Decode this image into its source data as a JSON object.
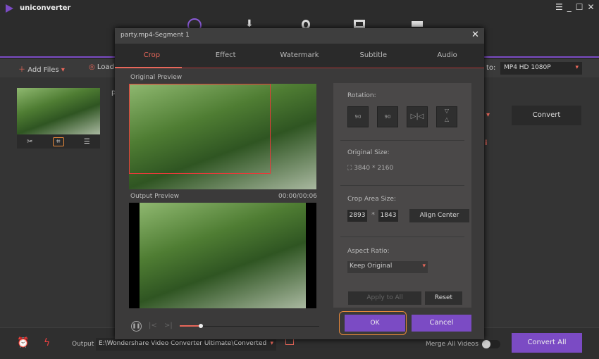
{
  "app": {
    "title": "uniconverter",
    "window_controls": [
      "menu-icon",
      "minimize-icon",
      "maximize-icon",
      "close-icon"
    ]
  },
  "nav_icons": [
    "convert-icon",
    "download-icon",
    "record-icon",
    "transfer-icon",
    "toolbox-icon"
  ],
  "toolbar": {
    "add_files": "Add Files",
    "load": "Load",
    "convert_to_label": "to:",
    "format": "MP4 HD 1080P"
  },
  "file": {
    "name_initial": "p",
    "convert": "Convert"
  },
  "dialog": {
    "title": "party.mp4-Segment 1",
    "tabs": [
      "Crop",
      "Effect",
      "Watermark",
      "Subtitle",
      "Audio"
    ],
    "active_tab": "Crop",
    "original_preview": "Original Preview",
    "output_preview": "Output Preview",
    "time": "00:00/00:06",
    "playback_progress": 0.15,
    "rotation_label": "Rotation:",
    "rotation_buttons": [
      "rotate-left-90",
      "rotate-right-90",
      "flip-horizontal",
      "flip-vertical"
    ],
    "rot_left_text": "90",
    "rot_right_text": "90",
    "original_size_label": "Original Size:",
    "original_size": "3840 * 2160",
    "crop_area_label": "Crop Area Size:",
    "crop_width": "2893",
    "crop_sep": "*",
    "crop_height": "1843",
    "align_center": "Align Center",
    "aspect_ratio_label": "Aspect Ratio:",
    "aspect_ratio": "Keep Original",
    "apply_to_all": "Apply to All",
    "reset": "Reset",
    "ok": "OK",
    "cancel": "Cancel"
  },
  "bottom": {
    "output_label": "Output",
    "output_path": "E:\\Wondershare Video Converter Ultimate\\Converted",
    "merge_label": "Merge All Videos",
    "merge_on": false,
    "convert_all": "Convert All"
  },
  "colors": {
    "accent": "#7b4bc4",
    "active_tab": "#e8675a",
    "highlight": "#e8893a"
  }
}
